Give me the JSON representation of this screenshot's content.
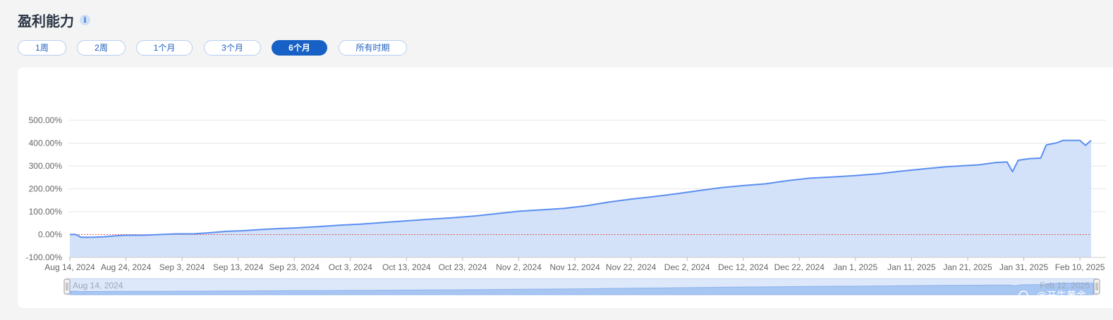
{
  "header": {
    "title": "盈利能力",
    "info_icon": "info-icon"
  },
  "tabs": [
    {
      "label": "1周",
      "active": false
    },
    {
      "label": "2周",
      "active": false
    },
    {
      "label": "1个月",
      "active": false
    },
    {
      "label": "3个月",
      "active": false
    },
    {
      "label": "6个月",
      "active": true
    },
    {
      "label": "所有时期",
      "active": false
    }
  ],
  "colors": {
    "accent": "#1760c5",
    "line": "#5b8ff0",
    "area": "#d3e1f9",
    "zero_line": "#e05a5a",
    "grid": "#e6e6e6"
  },
  "chart_data": {
    "type": "area",
    "yticks": [
      "-100.00%",
      "0.00%",
      "100.00%",
      "200.00%",
      "300.00%",
      "400.00%",
      "500.00%"
    ],
    "ylim": [
      -100,
      500
    ],
    "xticks": [
      "Aug 14, 2024",
      "Aug 24, 2024",
      "Sep 3, 2024",
      "Sep 13, 2024",
      "Sep 23, 2024",
      "Oct 3, 2024",
      "Oct 13, 2024",
      "Oct 23, 2024",
      "Nov 2, 2024",
      "Nov 12, 2024",
      "Nov 22, 2024",
      "Dec 2, 2024",
      "Dec 12, 2024",
      "Dec 22, 2024",
      "Jan 1, 2025",
      "Jan 11, 2025",
      "Jan 21, 2025",
      "Jan 31, 2025",
      "Feb 10, 2025"
    ],
    "x_start": "2024-08-14",
    "x_end": "2025-02-12",
    "grid": true,
    "reference_line": 0,
    "points": [
      [
        "2024-08-14",
        0
      ],
      [
        "2024-08-15",
        1
      ],
      [
        "2024-08-16",
        -12
      ],
      [
        "2024-08-18",
        -12
      ],
      [
        "2024-08-20",
        -10
      ],
      [
        "2024-08-22",
        -6
      ],
      [
        "2024-08-24",
        -3
      ],
      [
        "2024-08-27",
        -3
      ],
      [
        "2024-08-30",
        0
      ],
      [
        "2024-09-02",
        3
      ],
      [
        "2024-09-05",
        3
      ],
      [
        "2024-09-08",
        8
      ],
      [
        "2024-09-11",
        14
      ],
      [
        "2024-09-14",
        17
      ],
      [
        "2024-09-17",
        22
      ],
      [
        "2024-09-20",
        26
      ],
      [
        "2024-09-23",
        29
      ],
      [
        "2024-09-27",
        34
      ],
      [
        "2024-10-01",
        41
      ],
      [
        "2024-10-05",
        46
      ],
      [
        "2024-10-09",
        53
      ],
      [
        "2024-10-13",
        60
      ],
      [
        "2024-10-17",
        67
      ],
      [
        "2024-10-21",
        73
      ],
      [
        "2024-10-25",
        81
      ],
      [
        "2024-10-29",
        91
      ],
      [
        "2024-11-02",
        102
      ],
      [
        "2024-11-06",
        108
      ],
      [
        "2024-11-10",
        114
      ],
      [
        "2024-11-14",
        126
      ],
      [
        "2024-11-18",
        142
      ],
      [
        "2024-11-22",
        155
      ],
      [
        "2024-11-26",
        166
      ],
      [
        "2024-11-30",
        178
      ],
      [
        "2024-12-04",
        192
      ],
      [
        "2024-12-08",
        205
      ],
      [
        "2024-12-12",
        214
      ],
      [
        "2024-12-16",
        222
      ],
      [
        "2024-12-20",
        236
      ],
      [
        "2024-12-24",
        247
      ],
      [
        "2024-12-28",
        252
      ],
      [
        "2025-01-01",
        258
      ],
      [
        "2025-01-05",
        266
      ],
      [
        "2025-01-09",
        277
      ],
      [
        "2025-01-13",
        287
      ],
      [
        "2025-01-17",
        296
      ],
      [
        "2025-01-20",
        301
      ],
      [
        "2025-01-23",
        305
      ],
      [
        "2025-01-26",
        315
      ],
      [
        "2025-01-28",
        318
      ],
      [
        "2025-01-29",
        275
      ],
      [
        "2025-01-30",
        325
      ],
      [
        "2025-02-01",
        332
      ],
      [
        "2025-02-03",
        334
      ],
      [
        "2025-02-04",
        392
      ],
      [
        "2025-02-06",
        402
      ],
      [
        "2025-02-07",
        412
      ],
      [
        "2025-02-10",
        412
      ],
      [
        "2025-02-11",
        390
      ],
      [
        "2025-02-12",
        412
      ]
    ]
  },
  "navigator": {
    "start_label": "Aug 14, 2024",
    "end_label": "Feb 12, 2025"
  },
  "watermark": {
    "text": "@开牛黄金"
  }
}
